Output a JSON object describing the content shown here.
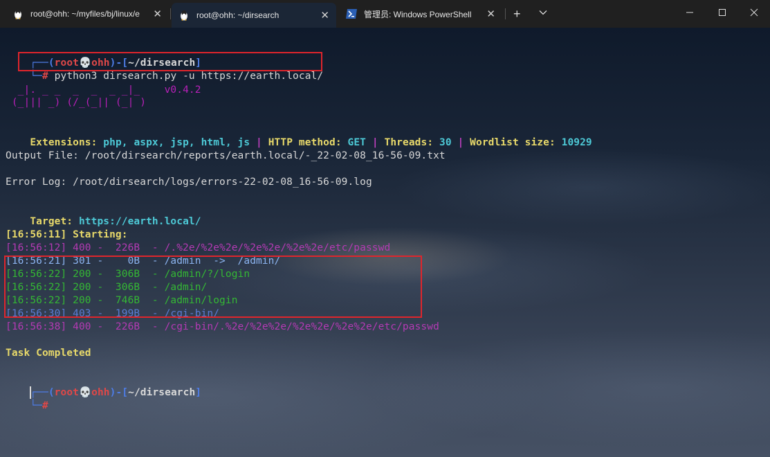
{
  "tabs": [
    {
      "label": "root@ohh: ~/myfiles/bj/linux/e",
      "icon": "linux-penguin-icon",
      "active": false
    },
    {
      "label": "root@ohh: ~/dirsearch",
      "icon": "linux-penguin-icon",
      "active": true
    },
    {
      "label": "管理员: Windows PowerShell",
      "icon": "powershell-icon",
      "active": false
    }
  ],
  "window_controls": {
    "minimize": "—",
    "maximize": "☐",
    "close": "✕"
  },
  "terminal": {
    "prompt1": {
      "open": "┌──(",
      "user": "root",
      "skull": "💀",
      "host": "ohh",
      "close": ")-[",
      "dir": "~/dirsearch",
      "end": "]"
    },
    "prompt1_line2": {
      "corner": "└─",
      "hash": "#",
      "command": " python3 dirsearch.py -u https://earth.local/"
    },
    "banner": {
      "line1": "  _|. _ _  _  _  _ _|_    ",
      "version": "v0.4.2",
      "line2": " (_||| _) (/_(_|| (_| )"
    },
    "extensions": {
      "label": "Extensions: ",
      "value": "php, aspx, jsp, html, js",
      "sep": " | ",
      "method_label": "HTTP method: ",
      "method": "GET",
      "threads_label": "Threads: ",
      "threads": "30",
      "wordlist_label": "Wordlist size: ",
      "wordlist": "10929"
    },
    "output_file": "Output File: /root/dirsearch/reports/earth.local/-_22-02-08_16-56-09.txt",
    "error_log": "Error Log: /root/dirsearch/logs/errors-22-02-08_16-56-09.log",
    "target": {
      "label": "Target: ",
      "value": "https://earth.local/"
    },
    "starting": "[16:56:11] Starting:",
    "results": [
      {
        "text": "[16:56:12] 400 -  226B  - /.%2e/%2e%2e/%2e%2e/%2e%2e/etc/passwd",
        "style": "purp"
      },
      {
        "text": "[16:56:21] 301 -    0B  - /admin  ->  /admin/",
        "style": "lblue"
      },
      {
        "text": "[16:56:22] 200 -  306B  - /admin/?/login",
        "style": "green"
      },
      {
        "text": "[16:56:22] 200 -  306B  - /admin/",
        "style": "green"
      },
      {
        "text": "[16:56:22] 200 -  746B  - /admin/login",
        "style": "green"
      },
      {
        "text": "[16:56:30] 403 -  199B  - /cgi-bin/",
        "style": "faint"
      },
      {
        "text": "[16:56:38] 400 -  226B  - /cgi-bin/.%2e/%2e%2e/%2e%2e/%2e%2e/etc/passwd",
        "style": "purp"
      }
    ],
    "completed": "Task Completed",
    "prompt2": {
      "open": "┌──(",
      "user": "root",
      "skull": "💀",
      "host": "ohh",
      "close": ")-[",
      "dir": "~/dirsearch",
      "end": "]"
    },
    "prompt2_line2": {
      "corner": "└─",
      "hash": "#"
    }
  },
  "colors": {
    "highlight_box": "#e0252c",
    "prompt_blue": "#4e7de8",
    "prompt_red": "#e04848"
  }
}
